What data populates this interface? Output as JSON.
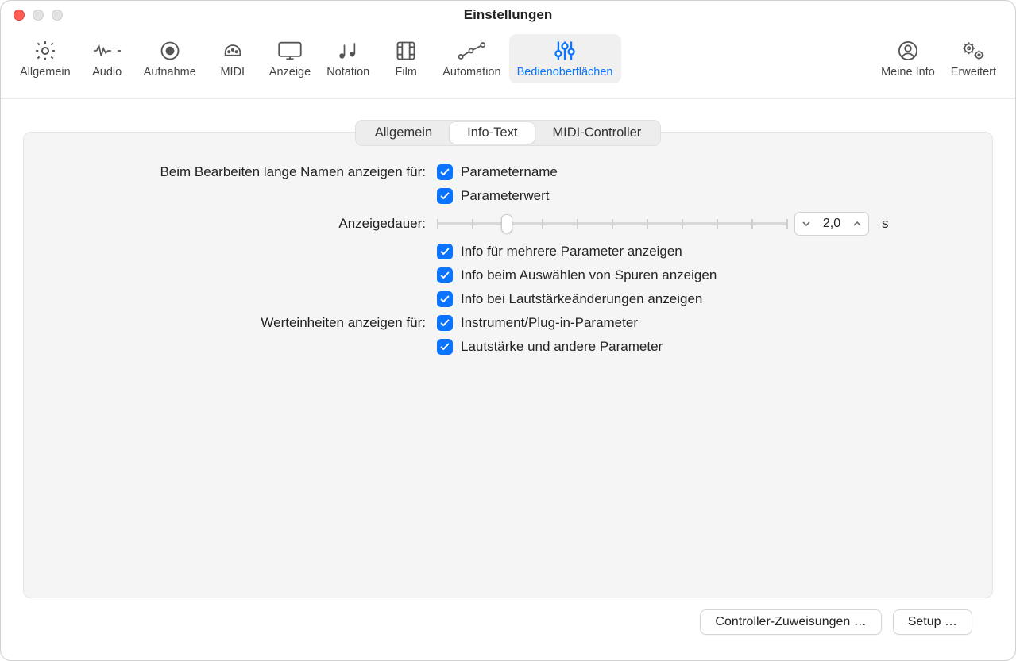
{
  "window": {
    "title": "Einstellungen"
  },
  "toolbar": {
    "items": [
      {
        "id": "allgemein",
        "label": "Allgemein"
      },
      {
        "id": "audio",
        "label": "Audio"
      },
      {
        "id": "aufnahme",
        "label": "Aufnahme"
      },
      {
        "id": "midi",
        "label": "MIDI"
      },
      {
        "id": "anzeige",
        "label": "Anzeige"
      },
      {
        "id": "notation",
        "label": "Notation"
      },
      {
        "id": "film",
        "label": "Film"
      },
      {
        "id": "automation",
        "label": "Automation"
      },
      {
        "id": "bedienoberflaechen",
        "label": "Bedienoberflächen",
        "selected": true
      },
      {
        "id": "meine-info",
        "label": "Meine Info"
      },
      {
        "id": "erweitert",
        "label": "Erweitert"
      }
    ]
  },
  "tabs": {
    "items": [
      {
        "id": "allgemein",
        "label": "Allgemein"
      },
      {
        "id": "info-text",
        "label": "Info-Text",
        "active": true
      },
      {
        "id": "midi-controller",
        "label": "MIDI-Controller"
      }
    ]
  },
  "form": {
    "long_names_label": "Beim Bearbeiten lange Namen anzeigen für:",
    "parameter_name": "Parametername",
    "parameter_value": "Parameterwert",
    "display_duration_label": "Anzeigedauer:",
    "display_duration_value": "2,0",
    "display_duration_unit": "s",
    "slider_percent": 20,
    "info_multiple": "Info für mehrere Parameter anzeigen",
    "info_select_tracks": "Info beim Auswählen von Spuren anzeigen",
    "info_volume": "Info bei Lautstärkeänderungen anzeigen",
    "value_units_label": "Werteinheiten anzeigen für:",
    "instrument_plugin": "Instrument/Plug-in-Parameter",
    "volume_other": "Lautstärke und andere Parameter"
  },
  "footer": {
    "controller_assignments": "Controller-Zuweisungen …",
    "setup": "Setup …"
  }
}
